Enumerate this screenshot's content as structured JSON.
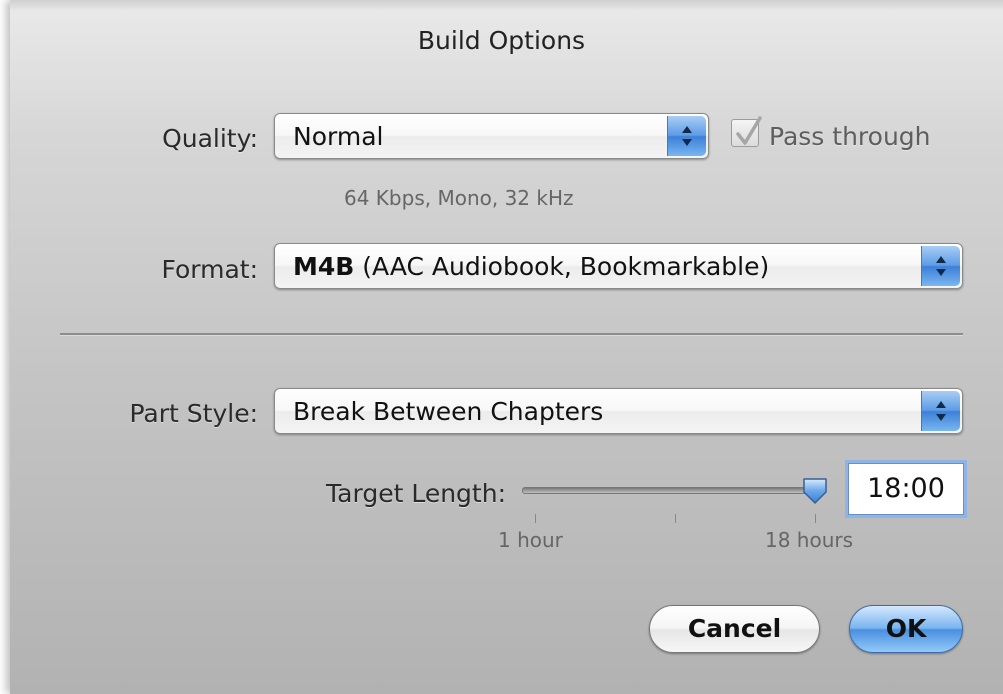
{
  "dialog": {
    "title": "Build Options"
  },
  "quality": {
    "label": "Quality:",
    "value": "Normal",
    "pass_through_label": "Pass through",
    "pass_through_checked": true,
    "detail": "64 Kbps, Mono, 32 kHz"
  },
  "format": {
    "label": "Format:",
    "value_bold": "M4B",
    "value_rest": " (AAC Audiobook, Bookmarkable)"
  },
  "part_style": {
    "label": "Part Style:",
    "value": "Break Between Chapters"
  },
  "target_length": {
    "label": "Target Length:",
    "value": "18:00",
    "min_label": "1 hour",
    "max_label": "18 hours",
    "slider_level": 1.0
  },
  "buttons": {
    "cancel_label": "Cancel",
    "ok_label": "OK"
  },
  "colors": {
    "accent": "#4a8fe0",
    "focus_ring": "#8fb4e8"
  },
  "icons": {
    "stepper": "up-down-arrows-icon",
    "check": "checkmark-icon",
    "slider_thumb": "slider-thumb-icon"
  }
}
